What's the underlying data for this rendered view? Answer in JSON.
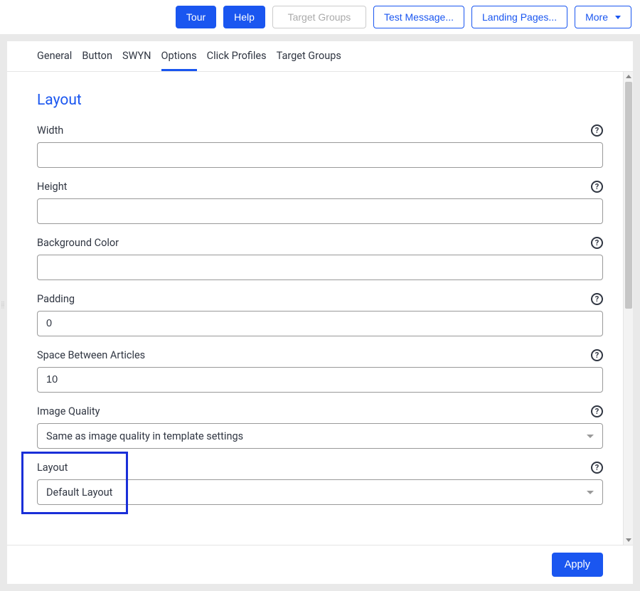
{
  "toolbar": {
    "tour": "Tour",
    "help": "Help",
    "target_groups": "Target Groups",
    "test_message": "Test Message...",
    "landing_pages": "Landing Pages...",
    "more": "More"
  },
  "tabs": {
    "general": "General",
    "button": "Button",
    "swyn": "SWYN",
    "options": "Options",
    "click_profiles": "Click Profiles",
    "target_groups": "Target Groups"
  },
  "section": {
    "title": "Layout"
  },
  "fields": {
    "width": {
      "label": "Width",
      "value": ""
    },
    "height": {
      "label": "Height",
      "value": ""
    },
    "background_color": {
      "label": "Background Color",
      "value": ""
    },
    "padding": {
      "label": "Padding",
      "value": "0"
    },
    "space_between": {
      "label": "Space Between Articles",
      "value": "10"
    },
    "image_quality": {
      "label": "Image Quality",
      "value": "Same as image quality in template settings"
    },
    "layout": {
      "label": "Layout",
      "value": "Default Layout"
    }
  },
  "footer": {
    "apply": "Apply"
  }
}
